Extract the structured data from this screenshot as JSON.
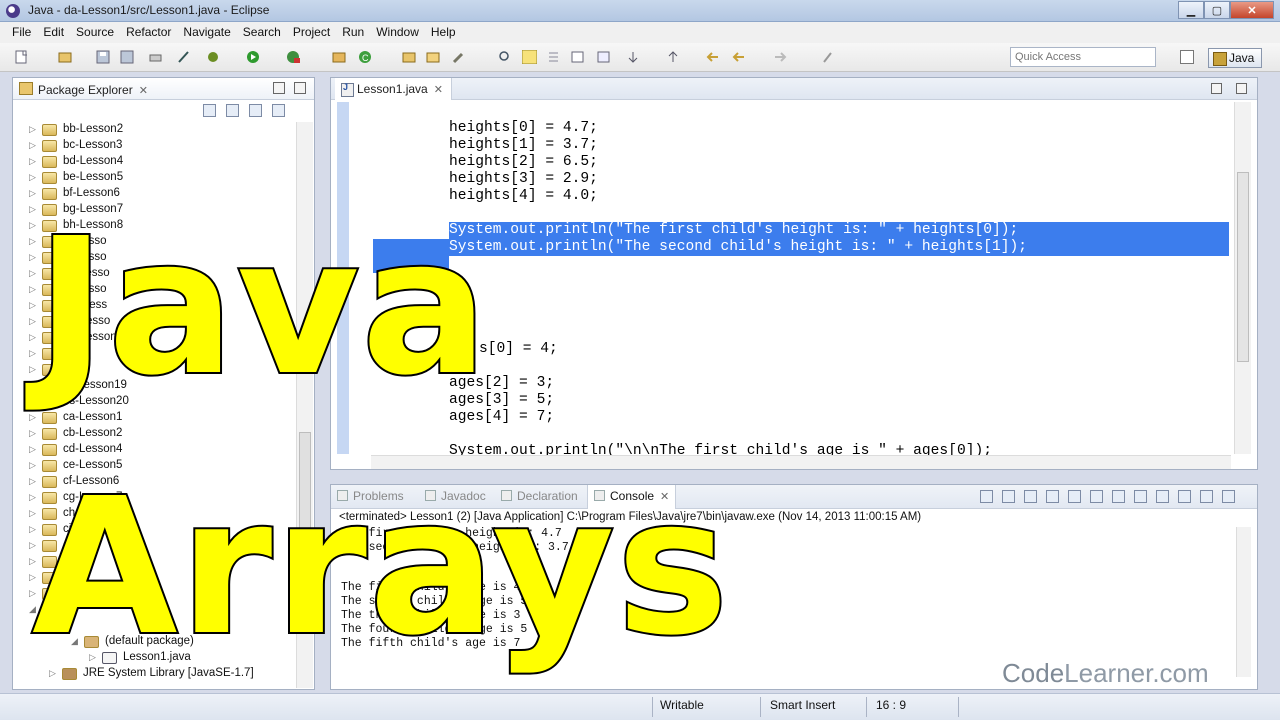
{
  "window": {
    "title": "Java - da-Lesson1/src/Lesson1.java - Eclipse"
  },
  "menu": [
    "File",
    "Edit",
    "Source",
    "Refactor",
    "Navigate",
    "Search",
    "Project",
    "Run",
    "Window",
    "Help"
  ],
  "toolbar": {
    "quick_access_placeholder": "Quick Access",
    "perspective": "Java"
  },
  "package_explorer": {
    "title": "Package Explorer",
    "tab_close": "✕",
    "items": [
      "bb-Lesson2",
      "bc-Lesson3",
      "bd-Lesson4",
      "be-Lesson5",
      "bf-Lesson6",
      "bg-Lesson7",
      "bh-Lesson8",
      "bi-Lesso",
      "bj-Lesso",
      "bk-Lesso",
      "bl-Lesso",
      "bm-Less",
      "bn-Lesso",
      "bo-Lesson",
      "bp",
      "bq",
      "br-Lesson19",
      "bs-Lesson20",
      "ca-Lesson1",
      "cb-Lesson2",
      "cd-Lesson4",
      "ce-Lesson5",
      "cf-Lesson6",
      "cg-Lesson7",
      "ch-L",
      "ci-L",
      "cj",
      "c",
      "h13",
      "",
      "",
      "",
      "(default package)",
      "Lesson1.java",
      "JRE System Library [JavaSE-1.7]"
    ]
  },
  "editor": {
    "tab": "Lesson1.java",
    "lines": [
      "heights[0] = 4.7;",
      "heights[1] = 3.7;",
      "heights[2] = 6.5;",
      "heights[3] = 2.9;",
      "heights[4] = 4.0;",
      "",
      "System.out.println(\"The first child's height is: \" + heights[0]);",
      "System.out.println(\"The second child's height is: \" + heights[1]);",
      "",
      "",
      "",
      "s[0] = 4;",
      "",
      "ages[2] = 3;",
      "ages[3] = 5;",
      "ages[4] = 7;",
      "",
      "System.out.println(\"\\n\\nThe first child's age is \" + ages[0]);"
    ]
  },
  "console_view": {
    "tabs": [
      "Problems",
      "Javadoc",
      "Declaration",
      "Console"
    ],
    "status": "<terminated> Lesson1 (2) [Java Application] C:\\Program Files\\Java\\jre7\\bin\\javaw.exe (Nov 14, 2013 11:00:15 AM)",
    "output": [
      "The first child's height is: 4.7",
      "The second child's height is: 3.7",
      "",
      "",
      "The first child's age is 4",
      "The second child's age is 5",
      "The third child's age is 3",
      "The fourth child's age is 5",
      "The fifth child's age is 7"
    ]
  },
  "statusbar": {
    "mode": "Writable",
    "insert": "Smart Insert",
    "position": "16 : 9"
  },
  "overlay": {
    "line1": "Java",
    "line2": "Arrays",
    "brand_code": "Code",
    "brand_rest": "Learner.com"
  },
  "colors": {
    "selection": "#3c7ded",
    "overlay_fill": "#ffff00",
    "overlay_stroke": "#000000"
  }
}
